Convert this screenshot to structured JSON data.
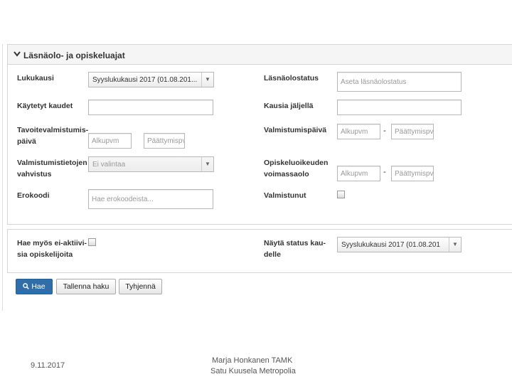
{
  "panel": {
    "title": "Läsnäolo- ja opiskeluajat"
  },
  "left": {
    "lukukausi_label": "Lukukausi",
    "lukukausi_value": "Syyslukukausi 2017 (01.08.201...",
    "kaytetyt_label": "Käytetyt kaudet",
    "tavoite_label_line1": "Tavoitevalmistumis-",
    "tavoite_label_line2": "päivä",
    "tavoite_start_placeholder": "Alkupvm",
    "tavoite_end_placeholder": "Päättymispv",
    "valmistumistiedot_label_line1": "Valmistumistietojen",
    "valmistumistiedot_label_line2": "vahvistus",
    "valmistumistiedot_value": "Ei valintaa",
    "erokoodi_label": "Erokoodi",
    "erokoodi_placeholder": "Hae erokoodeista..."
  },
  "right": {
    "lasnaolostatus_label": "Läsnäolostatus",
    "lasnaolostatus_placeholder": "Aseta läsnäolostatus",
    "kausia_label": "Kausia jäljellä",
    "valmistumispaiva_label": "Valmistumispäivä",
    "valmistumispaiva_start": "Alkupvm",
    "valmistumispaiva_end": "Päättymispv",
    "opiskeluoikeus_label_line1": "Opiskeluoikeuden",
    "opiskeluoikeus_label_line2": "voimassaolo",
    "opiskeluoikeus_start": "Alkupvm",
    "opiskeluoikeus_end": "Päättymispv",
    "valmistunut_label": "Valmistunut",
    "dash": "-"
  },
  "search": {
    "inactive_label_line1": "Hae myös ei-aktiivi-",
    "inactive_label_line2": "sia opiskelijoita",
    "status_label_line1": "Näytä status kau-",
    "status_label_line2": "delle",
    "status_value": "Syyslukukausi 2017 (01.08.201"
  },
  "buttons": {
    "search": "Hae",
    "save_search": "Tallenna haku",
    "clear": "Tyhjennä"
  },
  "footer": {
    "date": "9.11.2017",
    "author1": "Marja Honkanen TAMK",
    "author2": "Satu Kuusela Metropolia"
  }
}
